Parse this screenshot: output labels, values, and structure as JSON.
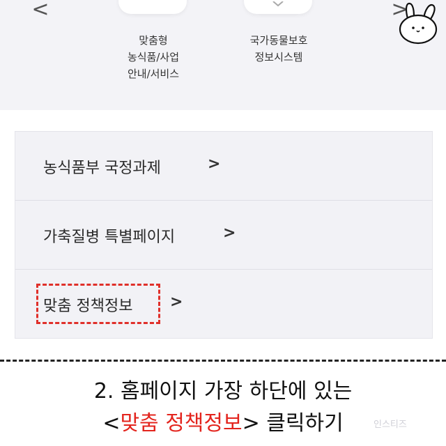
{
  "nav": {
    "prev_label": "<",
    "next_label": ">"
  },
  "services": [
    {
      "lines": [
        "맞춤형",
        "농식품/사업",
        "안내/서비스"
      ]
    },
    {
      "lines": [
        "국가동물보호",
        "정보시스템"
      ]
    }
  ],
  "menu": {
    "items": [
      {
        "label": "농식품부 국정과제",
        "chevron": ">"
      },
      {
        "label": "가축질병 특별페이지",
        "chevron": ">"
      },
      {
        "label": "맞춤 정책정보",
        "chevron": ">"
      }
    ]
  },
  "caption": {
    "line1": "2. 홈페이지 가장 하단에 있는",
    "line2_open": "<",
    "line2_highlight": "맞춤 정책정보",
    "line2_close": ">",
    "line2_rest": " 클릭하기"
  },
  "watermark": "인스티즈",
  "colors": {
    "highlight": "#e3241d",
    "panel_bg": "#f3f3f7",
    "menu_bg": "#f2f2f6"
  }
}
